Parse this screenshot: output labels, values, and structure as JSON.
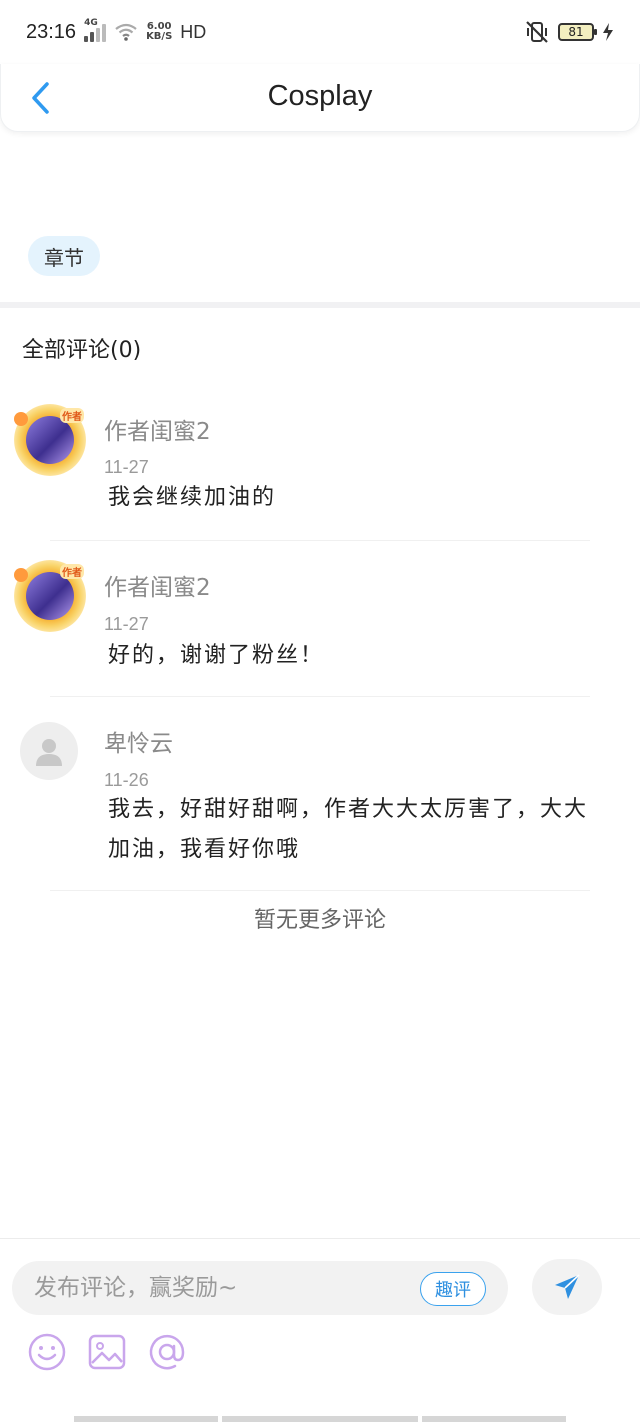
{
  "status_bar": {
    "time": "23:16",
    "network": "4G",
    "speed_value": "6.00",
    "speed_unit": "KB/S",
    "hd": "HD",
    "battery": "81"
  },
  "header": {
    "title": "Cosplay",
    "back_icon": "chevron-left-icon"
  },
  "chapter_tag": "章节",
  "comments_section": {
    "heading": "全部评论(0)",
    "items": [
      {
        "name": "作者闺蜜2",
        "date": "11-27",
        "text": "我会继续加油的",
        "avatar": "author",
        "avatar_badge": "作者"
      },
      {
        "name": "作者闺蜜2",
        "date": "11-27",
        "text": "好的，谢谢了粉丝！",
        "avatar": "author",
        "avatar_badge": "作者"
      },
      {
        "name": "卑怜云",
        "date": "11-26",
        "text": "我去，好甜好甜啊，作者大大太厉害了，大大加油，我看好你哦",
        "avatar": "default"
      }
    ],
    "no_more": "暂无更多评论"
  },
  "bottom_bar": {
    "placeholder": "发布评论，赢奖励~",
    "qu_ping": "趣评",
    "icons": [
      "emoji-icon",
      "image-icon",
      "at-icon",
      "send-icon"
    ]
  },
  "colors": {
    "accent": "#2f90e0",
    "tag_bg": "#e4f3fd",
    "icon_purple": "#c9a6ec"
  }
}
